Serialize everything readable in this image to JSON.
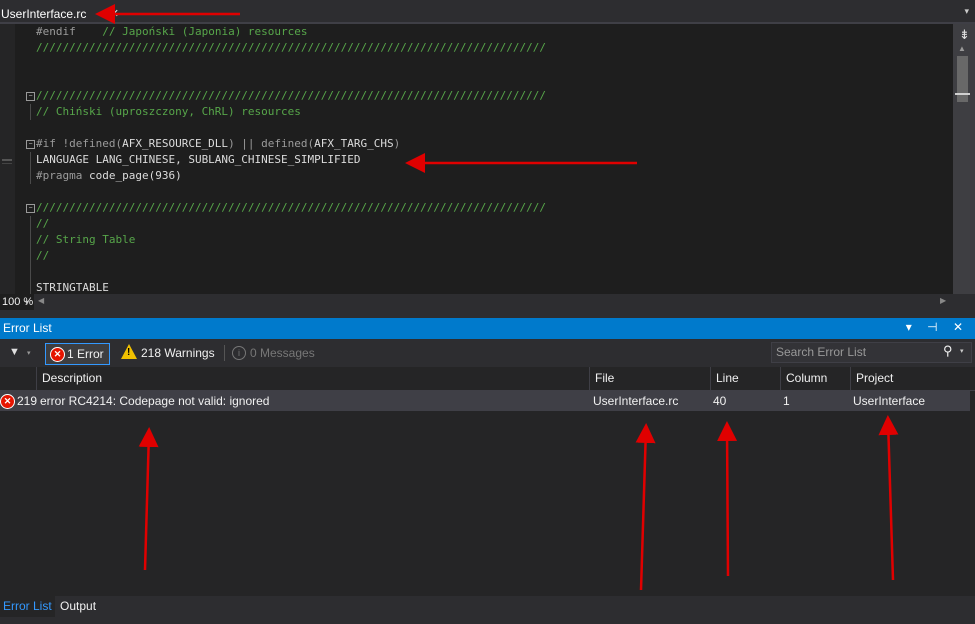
{
  "editor": {
    "tab_title": "UserInterface.rc",
    "tab_pin_icon": "pin-icon",
    "tab_close_icon": "close-icon",
    "zoom": "100 %",
    "lines": [
      {
        "segments": [
          {
            "t": "#endif",
            "c": "kw"
          },
          {
            "t": "    // Japoński (Japonia) resources",
            "c": "cmt"
          }
        ]
      },
      {
        "segments": [
          {
            "t": "/////////////////////////////////////////////////////////////////////////////",
            "c": "cmt"
          }
        ]
      },
      {
        "segments": []
      },
      {
        "segments": []
      },
      {
        "segments": [
          {
            "t": "/////////////////////////////////////////////////////////////////////////////",
            "c": "cmt"
          }
        ]
      },
      {
        "segments": [
          {
            "t": "// Chiński (uproszczony, ChRL) resources",
            "c": "cmt"
          }
        ]
      },
      {
        "segments": []
      },
      {
        "segments": [
          {
            "t": "#if !defined(",
            "c": "kw"
          },
          {
            "t": "AFX_RESOURCE_DLL",
            "c": "plain"
          },
          {
            "t": ") || defined(",
            "c": "kw"
          },
          {
            "t": "AFX_TARG_CHS",
            "c": "plain"
          },
          {
            "t": ")",
            "c": "kw"
          }
        ]
      },
      {
        "segments": [
          {
            "t": "LANGUAGE LANG_CHINESE, SUBLANG_CHINESE_SIMPLIFIED",
            "c": "plain"
          }
        ]
      },
      {
        "segments": [
          {
            "t": "#pragma",
            "c": "kw"
          },
          {
            "t": " code_page(936)",
            "c": "plain"
          }
        ]
      },
      {
        "segments": []
      },
      {
        "segments": [
          {
            "t": "/////////////////////////////////////////////////////////////////////////////",
            "c": "cmt"
          }
        ]
      },
      {
        "segments": [
          {
            "t": "//",
            "c": "cmt"
          }
        ]
      },
      {
        "segments": [
          {
            "t": "// String Table",
            "c": "cmt"
          }
        ]
      },
      {
        "segments": [
          {
            "t": "//",
            "c": "cmt"
          }
        ]
      },
      {
        "segments": []
      },
      {
        "segments": [
          {
            "t": "STRINGTABLE",
            "c": "plain"
          }
        ]
      }
    ]
  },
  "error_list": {
    "title": "Error List",
    "title_controls": "▾ ⊣ ✕",
    "errors_label": "1 Error",
    "warnings_label": "218 Warnings",
    "messages_label": "0 Messages",
    "search_placeholder": "Search Error List",
    "columns": [
      "Description",
      "File",
      "Line",
      "Column",
      "Project"
    ],
    "rows": [
      {
        "code_prefix": "219",
        "description": "error RC4214: Codepage not valid:  ignored",
        "file": "UserInterface.rc",
        "line": "40",
        "column": "1",
        "project": "UserInterface"
      }
    ]
  },
  "bottom_tabs": {
    "error_list": "Error List",
    "output": "Output"
  },
  "colors": {
    "accent": "#007acc",
    "editor_bg": "#1e1e1e",
    "comment": "#57a64a",
    "error_red": "#e51400",
    "warning_yellow": "#f0c000",
    "annotation_arrow": "#e00000"
  }
}
